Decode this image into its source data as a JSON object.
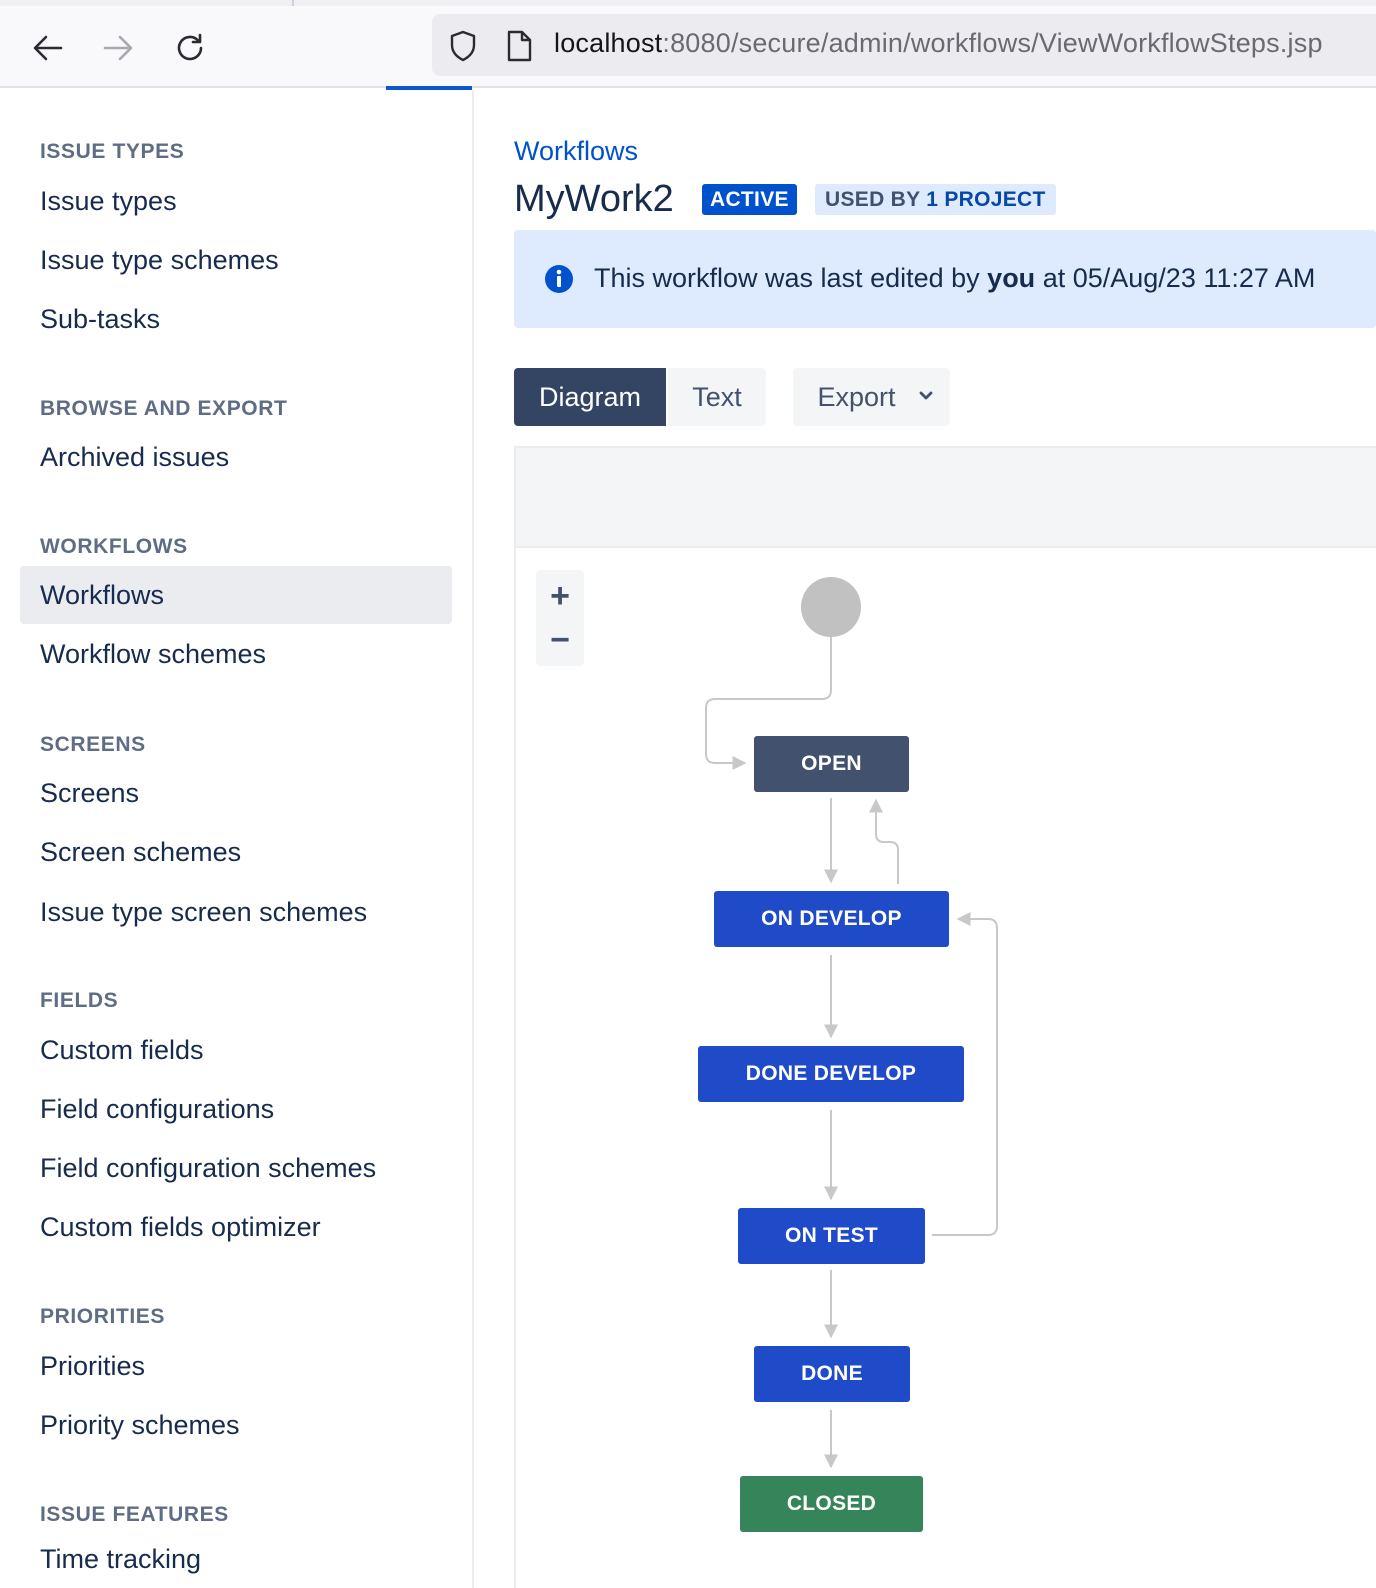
{
  "browser": {
    "url_host": "localhost",
    "url_rest": ":8080/secure/admin/workflows/ViewWorkflowSteps.jsp"
  },
  "sidebar": {
    "sections": [
      {
        "heading": "ISSUE TYPES",
        "items": [
          "Issue types",
          "Issue type schemes",
          "Sub-tasks"
        ]
      },
      {
        "heading": "BROWSE AND EXPORT",
        "items": [
          "Archived issues"
        ]
      },
      {
        "heading": "WORKFLOWS",
        "items": [
          "Workflows",
          "Workflow schemes"
        ]
      },
      {
        "heading": "SCREENS",
        "items": [
          "Screens",
          "Screen schemes",
          "Issue type screen schemes"
        ]
      },
      {
        "heading": "FIELDS",
        "items": [
          "Custom fields",
          "Field configurations",
          "Field configuration schemes",
          "Custom fields optimizer"
        ]
      },
      {
        "heading": "PRIORITIES",
        "items": [
          "Priorities",
          "Priority schemes"
        ]
      },
      {
        "heading": "ISSUE FEATURES",
        "items": [
          "Time tracking"
        ]
      }
    ],
    "selected": "Workflows"
  },
  "main": {
    "breadcrumb": "Workflows",
    "title": "MyWork2",
    "status_lozenge": "ACTIVE",
    "used_by_prefix": "USED BY",
    "used_by_count": "1 PROJECT",
    "banner": {
      "prefix": "This workflow was last edited by",
      "user": "you",
      "suffix": "at 05/Aug/23 11:27 AM"
    },
    "view_buttons": {
      "diagram": "Diagram",
      "text": "Text",
      "export": "Export"
    },
    "zoom": {
      "in": "+",
      "out": "−"
    }
  },
  "workflow": {
    "statuses": [
      {
        "name": "OPEN",
        "category": "todo"
      },
      {
        "name": "ON DEVELOP",
        "category": "progress"
      },
      {
        "name": "DONE DEVELOP",
        "category": "progress"
      },
      {
        "name": "ON TEST",
        "category": "progress"
      },
      {
        "name": "DONE",
        "category": "progress"
      },
      {
        "name": "CLOSED",
        "category": "done"
      }
    ],
    "colors": {
      "todo": "#42526e",
      "progress": "#1f4bc8",
      "done": "#36855a"
    }
  }
}
